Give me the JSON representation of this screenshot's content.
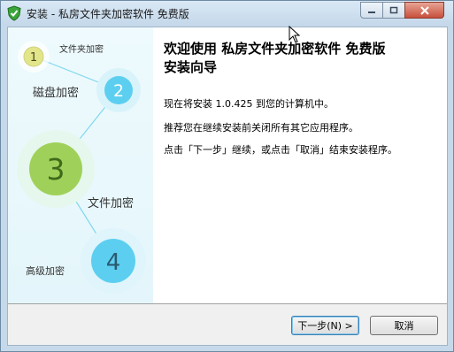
{
  "window": {
    "title": "安装 - 私房文件夹加密软件 免费版"
  },
  "window_controls": {
    "minimize_icon": "minimize-icon",
    "maximize_icon": "maximize-icon",
    "close_icon": "close-icon"
  },
  "sidebar": {
    "steps": [
      {
        "number": "1",
        "label": "文件夹加密"
      },
      {
        "number": "2",
        "label": "磁盘加密"
      },
      {
        "number": "3",
        "label": "文件加密"
      },
      {
        "number": "4",
        "label": "高级加密"
      }
    ]
  },
  "main": {
    "heading_line1": "欢迎使用 私房文件夹加密软件 免费版",
    "heading_line2": "安装向导",
    "para1": "现在将安装 1.0.425 到您的计算机中。",
    "para2": "推荐您在继续安装前关闭所有其它应用程序。",
    "para3": "点击「下一步」继续，或点击「取消」结束安装程序。"
  },
  "buttons": {
    "next": "下一步(N) >",
    "cancel": "取消"
  },
  "colors": {
    "accent_green": "#9fd15a",
    "accent_blue": "#5ccff0",
    "step1_yellow": "#e3e58a"
  }
}
